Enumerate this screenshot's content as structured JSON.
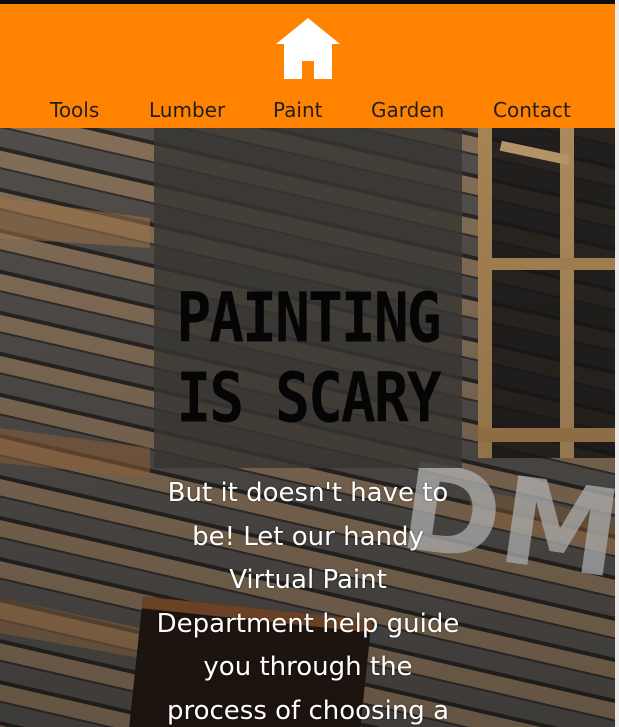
{
  "header": {
    "logo_icon": "home-icon",
    "background_color": "#ff8300",
    "nav": [
      {
        "label": "Tools"
      },
      {
        "label": "Lumber"
      },
      {
        "label": "Paint"
      },
      {
        "label": "Garden"
      },
      {
        "label": "Contact"
      }
    ]
  },
  "hero": {
    "title_line1": "PAINTING",
    "title_line2": "IS SCARY",
    "subtitle": "But it doesn't have to be! Let our handy Virtual Paint Department help guide you through the process of choosing a"
  }
}
